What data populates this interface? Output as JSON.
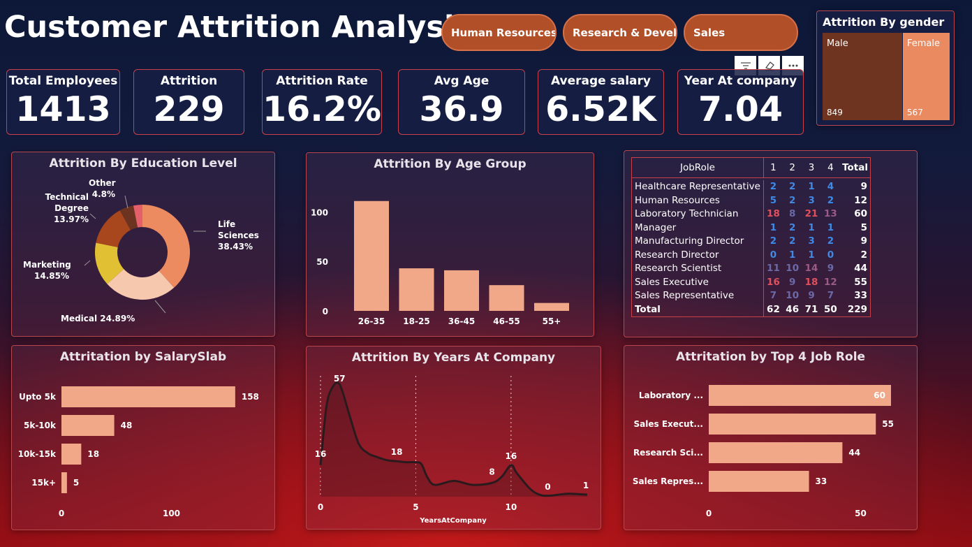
{
  "title": "Customer Attrition Analysis",
  "slicers": [
    "Human Resources",
    "Research & Devel...",
    "Sales"
  ],
  "kpis": [
    {
      "label": "Total Employees",
      "value": "1413"
    },
    {
      "label": "Attrition",
      "value": "229"
    },
    {
      "label": "Attrition Rate",
      "value": "16.2%"
    },
    {
      "label": "Avg Age",
      "value": "36.9"
    },
    {
      "label": "Average salary",
      "value": "6.52K"
    },
    {
      "label": "Year At company",
      "value": "7.04"
    }
  ],
  "toolbar": {
    "icons": [
      "filter-icon",
      "eraser-icon",
      "more-options-icon"
    ]
  },
  "gender": {
    "title": "Attrition By gender",
    "male_label": "Male",
    "male_value": "849",
    "male_color": "#6e3420",
    "female_label": "Female",
    "female_value": "567",
    "female_color": "#ea8a60"
  },
  "education": {
    "title": "Attrition By Education Level",
    "labels": {
      "life": "Life Sciences",
      "life_pct": "38.43%",
      "medical": "Medical 24.89%",
      "marketing": "Marketing",
      "marketing_pct": "14.85%",
      "technical": "Technical Degree",
      "technical_pct": "13.97%",
      "other": "Other",
      "other_pct": "4.8%"
    }
  },
  "age_chart_title": "Attrition By Age Group",
  "matrix": {
    "header": [
      "JobRole",
      "1",
      "2",
      "3",
      "4",
      "Total"
    ],
    "rows": [
      [
        "Healthcare Representative",
        "2",
        "2",
        "1",
        "4",
        "9"
      ],
      [
        "Human Resources",
        "5",
        "2",
        "3",
        "2",
        "12"
      ],
      [
        "Laboratory Technician",
        "18",
        "8",
        "21",
        "13",
        "60"
      ],
      [
        "Manager",
        "1",
        "2",
        "1",
        "1",
        "5"
      ],
      [
        "Manufacturing Director",
        "2",
        "2",
        "3",
        "2",
        "9"
      ],
      [
        "Research Director",
        "0",
        "1",
        "1",
        "0",
        "2"
      ],
      [
        "Research Scientist",
        "11",
        "10",
        "14",
        "9",
        "44"
      ],
      [
        "Sales Executive",
        "16",
        "9",
        "18",
        "12",
        "55"
      ],
      [
        "Sales Representative",
        "7",
        "10",
        "9",
        "7",
        "33"
      ]
    ],
    "total": [
      "Total",
      "62",
      "46",
      "71",
      "50",
      "229"
    ]
  },
  "salary_chart_title": "Attritation by SalarySlab",
  "years_chart_title": "Attrition By Years At Company",
  "top_roles_chart_title": "Attritation by Top 4 Job Role",
  "chart_data": [
    {
      "type": "pie",
      "title": "Attrition By Education Level",
      "categories": [
        "Life Sciences",
        "Medical",
        "Marketing",
        "Technical Degree",
        "Other",
        ""
      ],
      "values": [
        38.43,
        24.89,
        14.85,
        13.97,
        4.8,
        3.06
      ],
      "colors": [
        "#ec8a60",
        "#f6c8ae",
        "#e2c034",
        "#a8461e",
        "#6c3420",
        "#e3606a"
      ]
    },
    {
      "type": "bar",
      "title": "Attrition By Age Group",
      "categories": [
        "26-35",
        "18-25",
        "36-45",
        "46-55",
        "55+"
      ],
      "values": [
        111,
        43,
        41,
        26,
        8
      ],
      "yticks": [
        "0",
        "50",
        "100"
      ],
      "ylim": [
        0,
        120
      ],
      "color": "#f0a888"
    },
    {
      "type": "bar",
      "title": "Attritation by SalarySlab",
      "orientation": "horizontal",
      "categories": [
        "Upto 5k",
        "5k-10k",
        "10k-15k",
        "15k+"
      ],
      "values": [
        158,
        48,
        18,
        5
      ],
      "xticks": [
        "0",
        "100"
      ],
      "xlim": [
        0,
        160
      ],
      "color": "#f0a888"
    },
    {
      "type": "area",
      "title": "Attrition By Years At Company",
      "xlabel": "YearsAtCompany",
      "xticks": [
        "0",
        "5",
        "10"
      ],
      "x": [
        0,
        0.3,
        0.6,
        1,
        1.5,
        2,
        2.5,
        3,
        3.5,
        4,
        4.5,
        5,
        5.3,
        5.6,
        6,
        7,
        8,
        9,
        9.5,
        10,
        10.3,
        11,
        11.5,
        12,
        13,
        14
      ],
      "y": [
        16,
        45,
        55,
        57,
        42,
        27,
        22,
        20,
        18.5,
        18,
        17.5,
        17.5,
        16.5,
        10,
        6,
        8,
        6,
        7,
        10,
        16,
        12,
        4,
        1,
        0.5,
        1.5,
        1
      ],
      "labels": [
        {
          "x": 0,
          "y": 16,
          "text": "16"
        },
        {
          "x": 1,
          "y": 57,
          "text": "57"
        },
        {
          "x": 4,
          "y": 18,
          "text": "18"
        },
        {
          "x": 9,
          "y": 8,
          "text": "8"
        },
        {
          "x": 10,
          "y": 16,
          "text": "16"
        },
        {
          "x": 12,
          "y": 0,
          "text": "0"
        },
        {
          "x": 14,
          "y": 1,
          "text": "1"
        }
      ],
      "ylim": [
        0,
        62
      ],
      "xlim": [
        0,
        14
      ],
      "color": "#2a1a1e"
    },
    {
      "type": "bar",
      "title": "Attritation by Top 4 Job Role",
      "orientation": "horizontal",
      "categories": [
        "Laboratory ...",
        "Sales Execut...",
        "Research Sci...",
        "Sales Repres..."
      ],
      "values": [
        60,
        55,
        44,
        33
      ],
      "xticks": [
        "0",
        "50"
      ],
      "xlim": [
        0,
        65
      ],
      "color": "#f0a888"
    }
  ]
}
